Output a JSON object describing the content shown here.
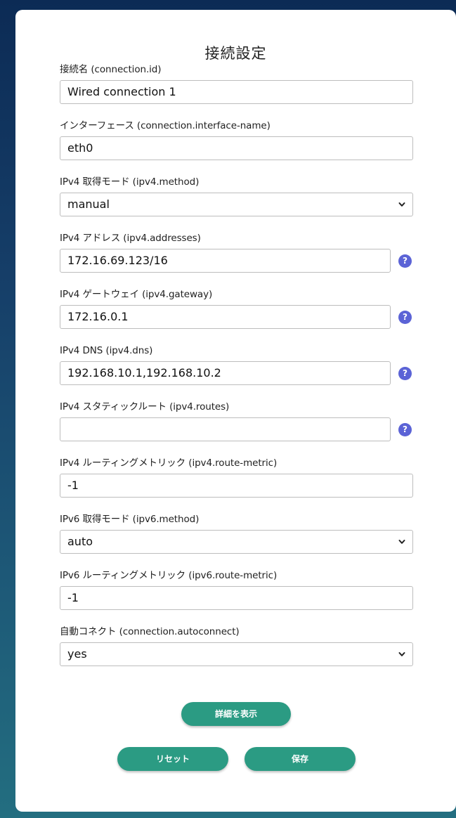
{
  "page": {
    "title": "接続設定"
  },
  "fields": {
    "connection_id": {
      "label": "接続名 (connection.id)",
      "value": "Wired connection 1"
    },
    "interface_name": {
      "label": "インターフェース (connection.interface-name)",
      "value": "eth0"
    },
    "ipv4_method": {
      "label": "IPv4 取得モード (ipv4.method)",
      "value": "manual"
    },
    "ipv4_addresses": {
      "label": "IPv4 アドレス (ipv4.addresses)",
      "value": "172.16.69.123/16",
      "help": "?"
    },
    "ipv4_gateway": {
      "label": "IPv4 ゲートウェイ (ipv4.gateway)",
      "value": "172.16.0.1",
      "help": "?"
    },
    "ipv4_dns": {
      "label": "IPv4 DNS (ipv4.dns)",
      "value": "192.168.10.1,192.168.10.2",
      "help": "?"
    },
    "ipv4_routes": {
      "label": "IPv4 スタティックルート (ipv4.routes)",
      "value": "",
      "help": "?"
    },
    "ipv4_route_metric": {
      "label": "IPv4 ルーティングメトリック (ipv4.route-metric)",
      "value": "-1"
    },
    "ipv6_method": {
      "label": "IPv6 取得モード (ipv6.method)",
      "value": "auto"
    },
    "ipv6_route_metric": {
      "label": "IPv6 ルーティングメトリック (ipv6.route-metric)",
      "value": "-1"
    },
    "autoconnect": {
      "label": "自動コネクト (connection.autoconnect)",
      "value": "yes"
    }
  },
  "buttons": {
    "details": "詳細を表示",
    "reset": "リセット",
    "save": "保存"
  },
  "icons": {
    "help": "question-circle-icon",
    "dropdown": "chevron-down-icon"
  },
  "colors": {
    "accent_button": "#2b9b83",
    "help_icon": "#5b63d6",
    "background_top": "#0c2b55",
    "background_bottom": "#236e80"
  }
}
